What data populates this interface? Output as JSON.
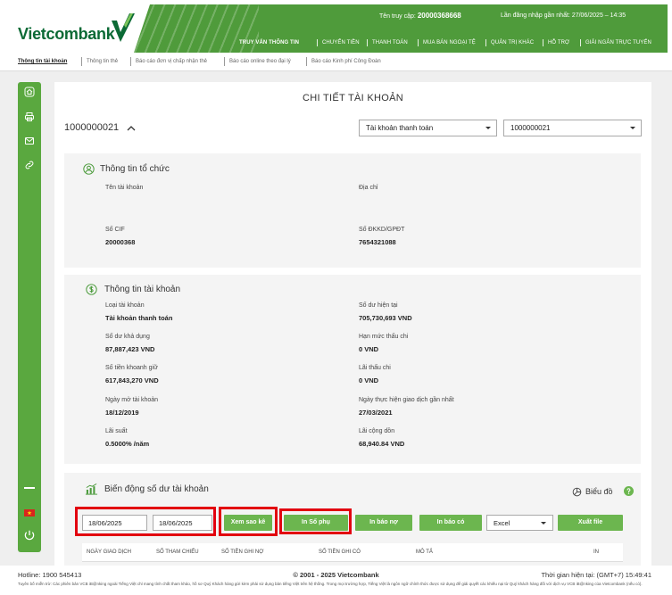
{
  "colors": {
    "brand_dark_green": "#0b6a35",
    "header_green": "#4f9b3b",
    "sidebar_green": "#5aa83f",
    "button_green": "#6cb64f",
    "icon_green": "#4a9a3a",
    "annotation_red": "#e2000f"
  },
  "header": {
    "logo_text": "Vietcombank",
    "username_label": "Tên truy cập:",
    "username": "20000368668",
    "last_login_label": "Lần đăng nhập gần nhất:",
    "last_login": "27/06/2025 – 14:35",
    "nav": [
      {
        "label": "TRUY VẤN THÔNG TIN",
        "active": true
      },
      {
        "label": "CHUYỂN TIỀN"
      },
      {
        "label": "THANH TOÁN"
      },
      {
        "label": "MUA BÁN NGOẠI TỆ"
      },
      {
        "label": "QUẢN TRỊ KHÁC"
      },
      {
        "label": "HỖ TRỢ"
      },
      {
        "label": "GIẢI NGÂN TRỰC TUYẾN"
      }
    ]
  },
  "subnav": [
    {
      "label": "Thông tin tài khoản",
      "active": true
    },
    {
      "label": "Thông tin thẻ"
    },
    {
      "label": "Báo cáo đơn vị chấp nhận thẻ"
    },
    {
      "label": "Báo cáo online theo đại lý"
    },
    {
      "label": "Báo cáo Kinh phí Công Đoàn"
    }
  ],
  "sidebar": {
    "icons": [
      "home-icon",
      "print-icon",
      "mail-icon",
      "link-icon",
      "vietnam-flag-icon",
      "power-icon"
    ]
  },
  "page_title": "CHI TIẾT TÀI KHOẢN",
  "account_selector": {
    "account_number": "1000000021",
    "account_type_selected": "Tài khoản thanh toán",
    "account_selected": "1000000021"
  },
  "organization": {
    "title": "Thông tin tổ chức",
    "account_name_label": "Tên tài khoản",
    "address_label": "Địa chỉ",
    "cif_label": "Số CIF",
    "cif_value": "20000368",
    "business_reg_label": "Số ĐKKD/GPĐT",
    "business_reg_value": "7654321088"
  },
  "account_info": {
    "title": "Thông tin tài khoản",
    "fields": [
      {
        "label": "Loại tài khoản",
        "value": "Tài khoản thanh toán"
      },
      {
        "label": "Số dư hiện tại",
        "value": "705,730,693 VND"
      },
      {
        "label": "Số dư khả dụng",
        "value": "87,887,423 VND"
      },
      {
        "label": "Hạn mức thấu chi",
        "value": "0 VND"
      },
      {
        "label": "Số tiền khoanh giữ",
        "value": "617,843,270 VND"
      },
      {
        "label": "Lãi thấu chi",
        "value": "0 VND"
      },
      {
        "label": "Ngày mở tài khoản",
        "value": "18/12/2019"
      },
      {
        "label": "Ngày thực hiện giao dịch gần nhất",
        "value": "27/03/2021"
      },
      {
        "label": "Lãi suất",
        "value": "0.5000% /năm"
      },
      {
        "label": "Lãi cộng dồn",
        "value": "68,940.84 VND"
      }
    ]
  },
  "balance_movement": {
    "title": "Biến động số dư tài khoản",
    "chart_link": "Biểu đồ",
    "from_date": "18/06/2025",
    "to_date": "18/06/2025",
    "buttons": {
      "view_statement": "Xem sao kê",
      "print_ledger": "In Sổ phụ",
      "print_debit_note": "In báo nợ",
      "print_credit_note": "In báo có",
      "export_file": "Xuất file"
    },
    "export_format": "Excel",
    "table_headers": [
      "NGÀY GIAO DỊCH",
      "SỐ THAM CHIẾU",
      "SỐ TIỀN GHI NỢ",
      "SỐ TIỀN GHI CÓ",
      "MÔ TẢ",
      "IN"
    ]
  },
  "footer": {
    "hotline": "Hotline: 1900 545413",
    "copyright": "© 2001 - 2025 Vietcombank",
    "current_time": "Thời gian hiện tại: (GMT+7) 15:49:41",
    "disclaimer": "Tuyên bố miễn trừ: Các phiên bản VCB iB@nking ngoài Tiếng Việt chỉ mang tính chất tham khảo, hồ sơ Quý Khách hàng gửi kèm phải sử dụng bản tiếng Việt trên hệ thống. Trong mọi trường hợp, Tiếng Việt là ngôn ngữ chính thức được sử dụng để giải quyết các khiếu nại từ Quý khách hàng đối với dịch vụ VCB iB@nking của Vietcombank (nếu có)."
  }
}
